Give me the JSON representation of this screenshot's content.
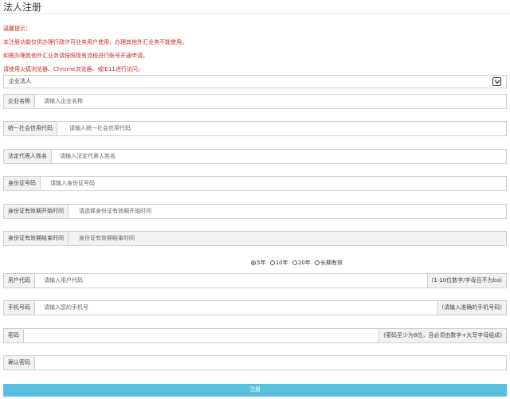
{
  "page": {
    "title": "法人注册"
  },
  "notice": {
    "lines": [
      "温馨提示：",
      "本注册功能仅供办理行政许可业务用户使用，办理其他外汇业务不能使用。",
      "如需办理其他外汇业务请按照现有流程进行账号开通申请。",
      "请使用火狐浏览器、Chrome浏览器、或IE11进行访问。"
    ]
  },
  "entity_type": {
    "value": "企业法人"
  },
  "form": {
    "company_name": {
      "label": "企业名称",
      "placeholder": "请输入企业名称"
    },
    "credit_code": {
      "label": "统一社会信用代码",
      "placeholder": "请输入统一社会信用代码"
    },
    "legal_rep": {
      "label": "法定代表人姓名",
      "placeholder": "请输入法定代表人姓名"
    },
    "id_number": {
      "label": "身份证号码",
      "placeholder": "请输入身份证号码"
    },
    "id_start": {
      "label": "身份证有效期开始时间",
      "placeholder": "请选择身份证有效期开始时间"
    },
    "id_end": {
      "label": "身份证有效期结束时间",
      "placeholder": "身份证有效期结束时间"
    },
    "validity": {
      "options": [
        "5年",
        "10年",
        "20年",
        "长期有效"
      ],
      "selected": "5年"
    },
    "user_code": {
      "label": "用户代码",
      "placeholder": "请输入用户代码",
      "hint": "(1-10位数字/字母且不为ba)"
    },
    "phone": {
      "label": "手机号码",
      "placeholder": "请输入您的手机号",
      "hint": "(请输入准确的手机号码)"
    },
    "password": {
      "label": "密码",
      "placeholder": "",
      "hint": "(密码至少为8位，且必须由数字+大写字母组成)"
    },
    "confirm_password": {
      "label": "确认密码",
      "placeholder": ""
    }
  },
  "submit": {
    "label": "注册"
  },
  "colors": {
    "notice": "#d0281e",
    "submit_bg": "#5bc0de",
    "label_bg": "#f2f2f2"
  }
}
